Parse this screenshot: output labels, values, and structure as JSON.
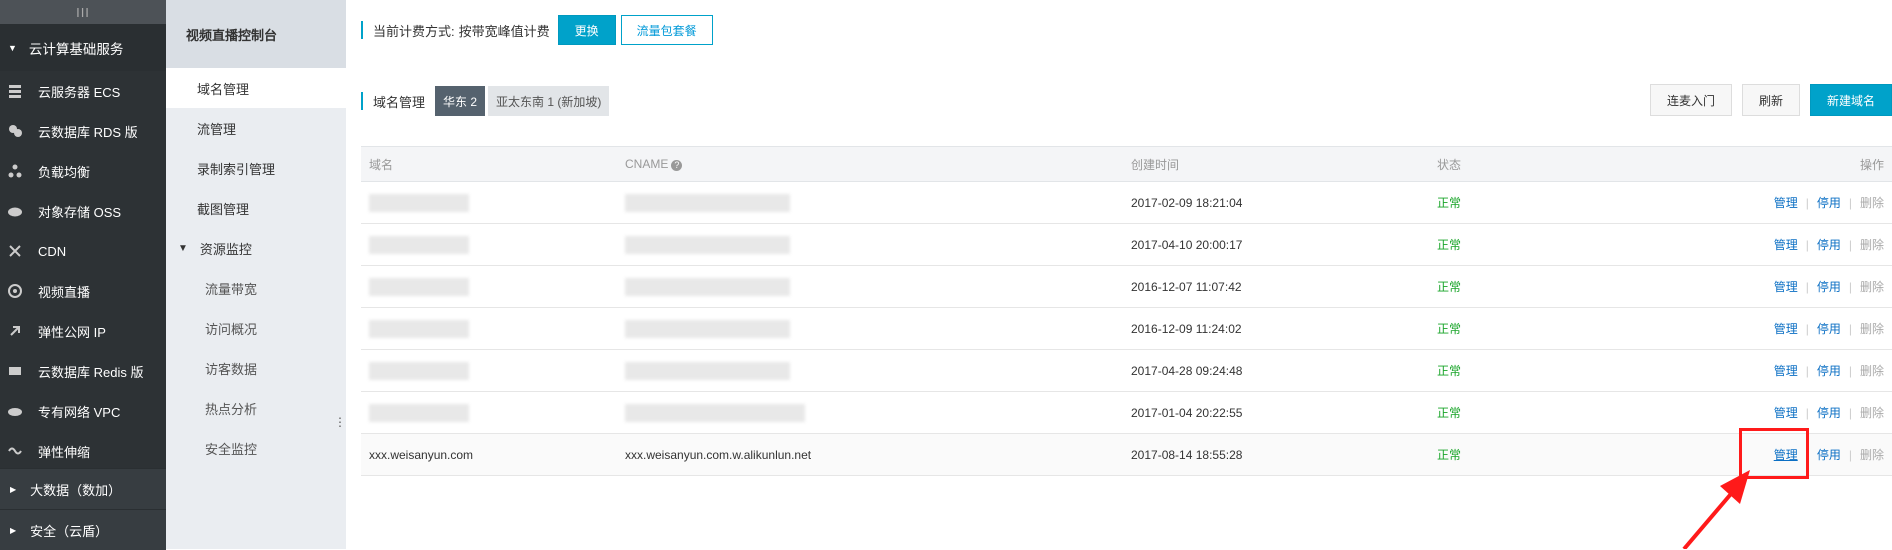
{
  "nav": {
    "collapse": "III",
    "group": "云计算基础服务",
    "items": [
      {
        "label": "云服务器 ECS",
        "icon": "server-icon"
      },
      {
        "label": "云数据库 RDS 版",
        "icon": "database-icon"
      },
      {
        "label": "负载均衡",
        "icon": "load-balancer-icon"
      },
      {
        "label": "对象存储 OSS",
        "icon": "cloud-storage-icon"
      },
      {
        "label": "CDN",
        "icon": "cdn-icon"
      },
      {
        "label": "视频直播",
        "icon": "live-video-icon"
      },
      {
        "label": "弹性公网 IP",
        "icon": "elastic-ip-icon"
      },
      {
        "label": "云数据库 Redis 版",
        "icon": "redis-icon"
      },
      {
        "label": "专有网络 VPC",
        "icon": "vpc-icon"
      },
      {
        "label": "弹性伸缩",
        "icon": "auto-scaling-icon"
      }
    ],
    "lower_groups": [
      "大数据（数加）",
      "安全（云盾）"
    ]
  },
  "sub": {
    "title": "视频直播控制台",
    "items": [
      "域名管理",
      "流管理",
      "录制索引管理",
      "截图管理"
    ],
    "group": "资源监控",
    "children": [
      "流量带宽",
      "访问概况",
      "访客数据",
      "热点分析",
      "安全监控"
    ]
  },
  "billing": {
    "label": "当前计费方式:",
    "value": "按带宽峰值计费",
    "change_btn": "更换",
    "package_btn": "流量包套餐"
  },
  "domain_bar": {
    "label": "域名管理",
    "tabs": [
      "华东 2",
      "亚太东南 1 (新加坡)"
    ],
    "btn_guide": "连麦入门",
    "btn_refresh": "刷新",
    "btn_new": "新建域名"
  },
  "table": {
    "headers": [
      "域名",
      "CNAME",
      "创建时间",
      "状态",
      "操作"
    ],
    "rows": [
      {
        "domain": "",
        "cname": "",
        "time": "2017-02-09 18:21:04",
        "status": "正常"
      },
      {
        "domain": "",
        "cname": "",
        "time": "2017-04-10 20:00:17",
        "status": "正常"
      },
      {
        "domain": "",
        "cname": "",
        "time": "2016-12-07 11:07:42",
        "status": "正常"
      },
      {
        "domain": "",
        "cname": "",
        "time": "2016-12-09 11:24:02",
        "status": "正常"
      },
      {
        "domain": "",
        "cname": "",
        "time": "2017-04-28 09:24:48",
        "status": "正常"
      },
      {
        "domain": "",
        "cname": "",
        "time": "2017-01-04 20:22:55",
        "status": "正常"
      },
      {
        "domain": "xxx.weisanyun.com",
        "cname": "xxx.weisanyun.com.w.alikunlun.net",
        "time": "2017-08-14 18:55:28",
        "status": "正常"
      }
    ],
    "op_manage": "管理",
    "op_disable": "停用",
    "op_delete": "删除"
  }
}
